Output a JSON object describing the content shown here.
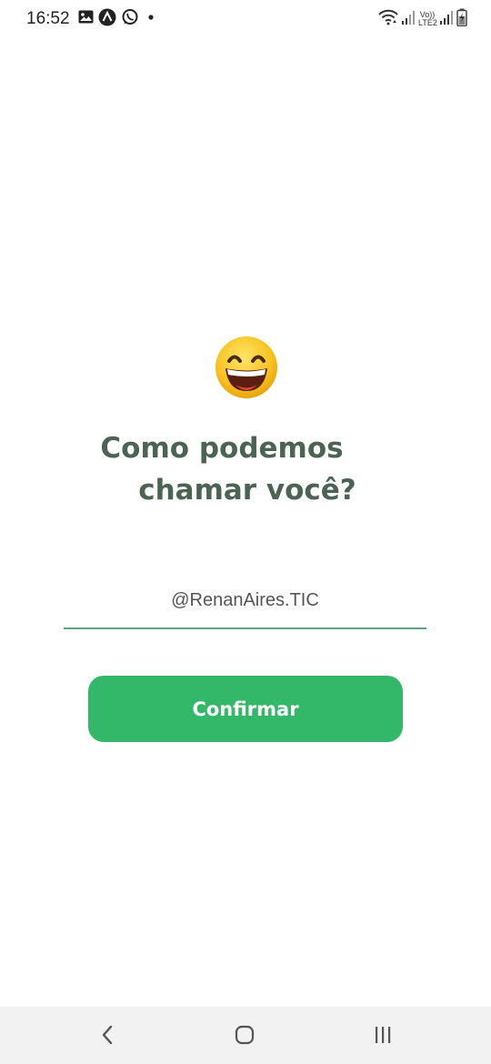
{
  "status_bar": {
    "time": "16:52",
    "left_icons": [
      "image-icon",
      "app-logo-icon",
      "whatsapp-icon",
      "dot-icon"
    ],
    "right_icons": [
      "wifi-icon",
      "signal-icon",
      "volte-lte2-icon",
      "signal-icon",
      "battery-charging-icon"
    ],
    "network_label_top": "Vo))",
    "network_label_bottom": "LTE2"
  },
  "main": {
    "emoji_icon": "grinning-face-with-smiling-eyes-icon",
    "title_line1": "Como podemos",
    "title_line2": "chamar você?",
    "nickname_value": "@RenanAires.TIC",
    "confirm_label": "Confirmar"
  },
  "nav_bar": {
    "back_icon": "back-chevron-icon",
    "home_icon": "home-icon",
    "recents_icon": "recents-icon"
  },
  "colors": {
    "title": "#4b6353",
    "accent": "#33b86a",
    "underline": "#5ca877",
    "nav_background": "#f2f2f2"
  }
}
